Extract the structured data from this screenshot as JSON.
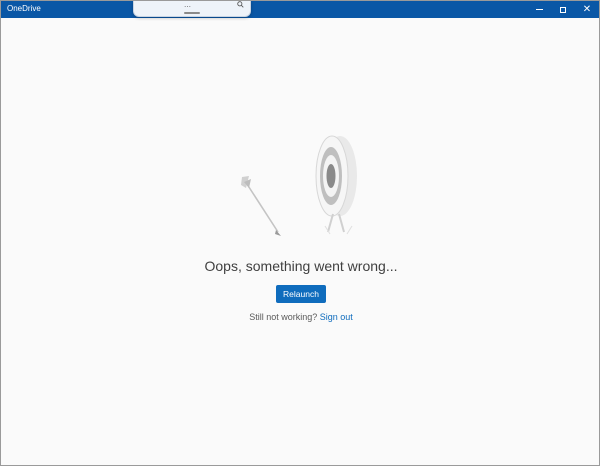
{
  "window": {
    "title": "OneDrive",
    "controls": {
      "minimize_icon": "minimize-icon",
      "maximize_icon": "maximize-icon",
      "close_icon": "close-icon",
      "close_glyph": "✕"
    }
  },
  "floating_search": {
    "text": "…",
    "icon": "search-icon"
  },
  "error": {
    "illustration_icon": "target-arrow-illustration",
    "title": "Oops, something went wrong...",
    "relaunch_label": "Relaunch",
    "help_prefix": "Still not working?",
    "sign_out_label": "Sign out"
  },
  "colors": {
    "titlebar": "#0a57a6",
    "accent": "#0f6cbd",
    "background": "#fafafa"
  }
}
